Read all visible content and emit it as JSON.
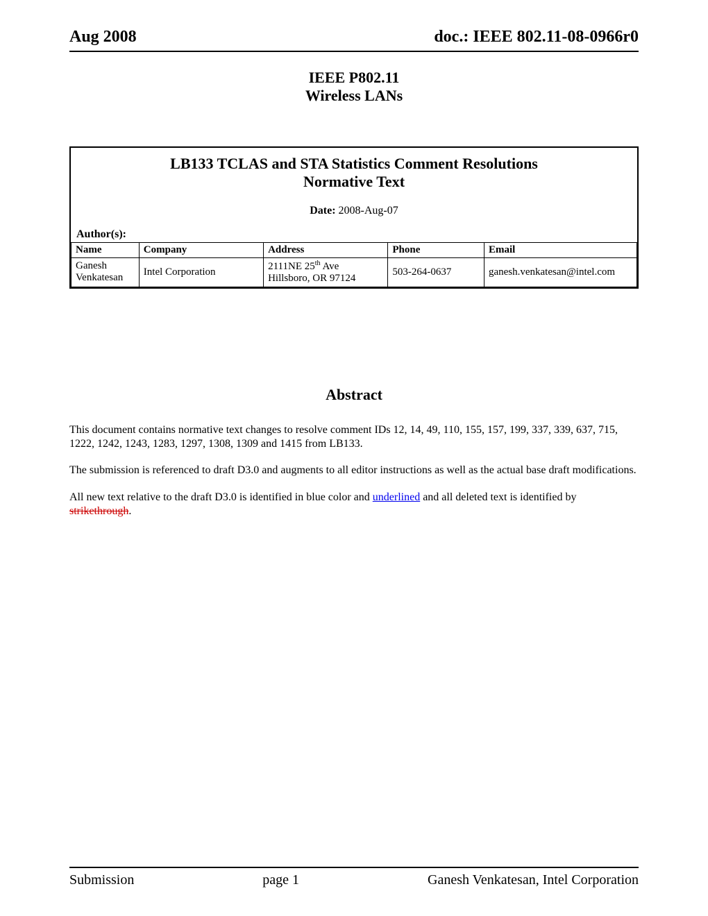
{
  "header": {
    "left": "Aug 2008",
    "right": "doc.: IEEE 802.11-08-0966r0"
  },
  "title": {
    "line1": "IEEE P802.11",
    "line2": "Wireless LANs"
  },
  "box": {
    "title_line1": "LB133 TCLAS and STA Statistics Comment Resolutions",
    "title_line2": "Normative Text",
    "date_label": "Date:",
    "date_value": "  2008-Aug-07",
    "authors_label": "Author(s):",
    "columns": {
      "name": "Name",
      "company": "Company",
      "address": "Address",
      "phone": "Phone",
      "email": "Email"
    },
    "authors": [
      {
        "name": "Ganesh Venkatesan",
        "company": "Intel Corporation",
        "address_line1_pre": "2111NE 25",
        "address_line1_sup": "th",
        "address_line1_post": " Ave",
        "address_line2": "Hillsboro, OR 97124",
        "phone": "503-264-0637",
        "email": "ganesh.venkatesan@intel.com"
      }
    ]
  },
  "abstract": {
    "heading": "Abstract",
    "p1": "This document contains normative text changes to resolve comment IDs 12, 14, 49, 110,  155, 157, 199, 337, 339, 637, 715, 1222, 1242, 1243, 1283, 1297, 1308, 1309 and 1415 from LB133.",
    "p2": "The submission is referenced to draft D3.0 and augments to all editor instructions as well as the actual base draft modifications.",
    "p3_pre": "All new text relative to the draft D3.0 is identified in blue color and ",
    "p3_underlined": "underlined",
    "p3_mid": " and all deleted text is identified by ",
    "p3_strike": "strikethrough",
    "p3_post": "."
  },
  "footer": {
    "left": "Submission",
    "center": "page 1",
    "right": "Ganesh Venkatesan, Intel Corporation"
  }
}
